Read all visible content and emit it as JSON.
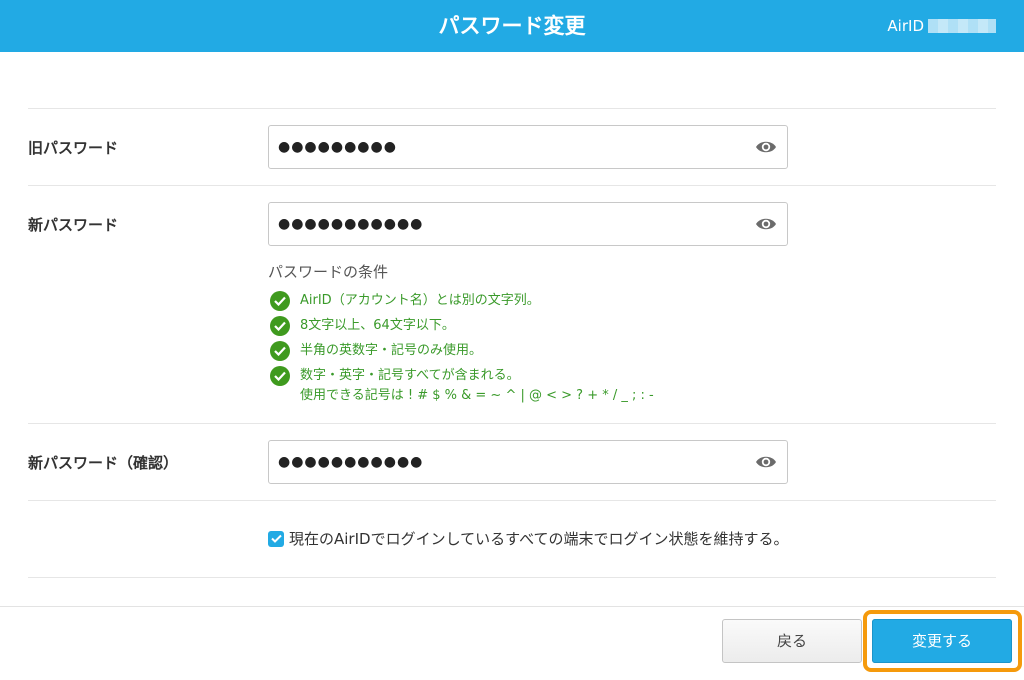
{
  "header": {
    "title": "パスワード変更",
    "user_label": "AirID"
  },
  "form": {
    "old_password": {
      "label": "旧パスワード",
      "value": "●●●●●●●●●"
    },
    "new_password": {
      "label": "新パスワード",
      "value": "●●●●●●●●●●●"
    },
    "conditions": {
      "title": "パスワードの条件",
      "items": [
        {
          "text": "AirID（アカウント名）とは別の文字列。"
        },
        {
          "text": "8文字以上、64文字以下。"
        },
        {
          "text": "半角の英数字・記号のみ使用。"
        },
        {
          "text": "数字・英字・記号すべてが含まれる。",
          "sub": "使用できる記号は ! # $ % & = ~ ^ | @ < > ? + * / _ ; : -"
        }
      ]
    },
    "confirm_password": {
      "label": "新パスワード（確認）",
      "value": "●●●●●●●●●●●"
    },
    "keep_login": {
      "checked": true,
      "label": "現在のAirIDでログインしているすべての端末でログイン状態を維持する。"
    }
  },
  "footer": {
    "back_label": "戻る",
    "submit_label": "変更する"
  },
  "colors": {
    "header_bg": "#22aae4",
    "check_green": "#3f9a1e",
    "highlight": "#f59a0c"
  }
}
